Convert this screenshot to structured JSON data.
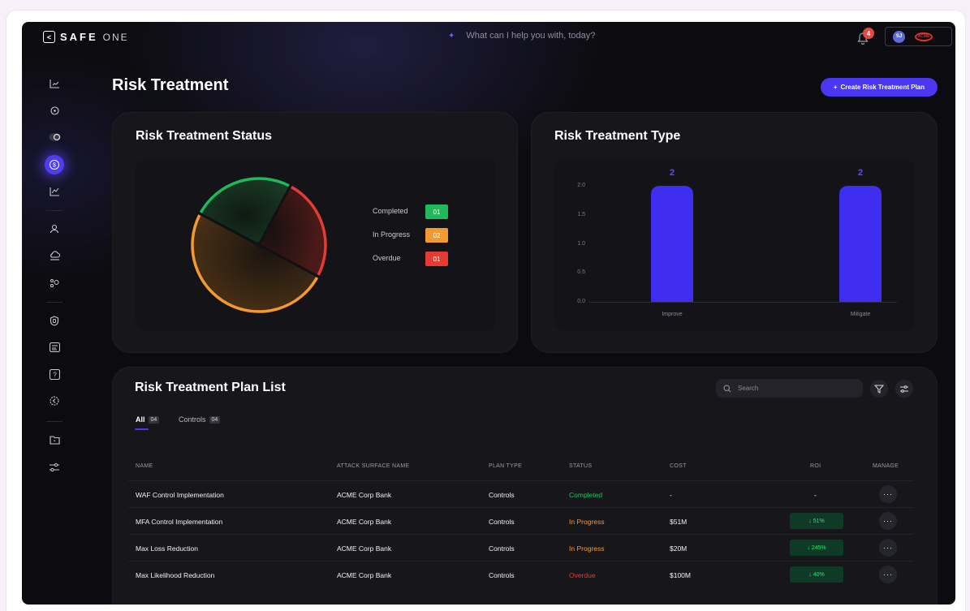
{
  "brand": {
    "logo_glyph": "<",
    "name_bold": "SAFE",
    "name_light": "ONE"
  },
  "assistant": {
    "placeholder": "What can I help you with, today?"
  },
  "notifications": {
    "count": "4"
  },
  "profile": {
    "initials": "SJ",
    "org_logo_text": "ACME"
  },
  "sidebar": {
    "items": [
      "chart-icon",
      "target-icon",
      "toggle-icon",
      "dollar-icon",
      "line-chart-icon",
      "user-icon",
      "cloud-icon",
      "nodes-icon",
      "shield-icon",
      "browser-icon",
      "help-icon",
      "settings-icon",
      "folder-icon",
      "sliders-icon"
    ],
    "active": "dollar-icon"
  },
  "page": {
    "title": "Risk Treatment",
    "create_label": "Create Risk Treatment Plan"
  },
  "status_card": {
    "title": "Risk Treatment Status",
    "legend": [
      {
        "label": "Completed",
        "value": "01",
        "color": "#1fb85a"
      },
      {
        "label": "In Progress",
        "value": "02",
        "color": "#f29a32"
      },
      {
        "label": "Overdue",
        "value": "01",
        "color": "#e63b32"
      }
    ]
  },
  "type_card": {
    "title": "Risk Treatment Type"
  },
  "chart_data": [
    {
      "type": "pie",
      "labels": [
        "Completed",
        "In Progress",
        "Overdue"
      ],
      "values": [
        1,
        2,
        1
      ],
      "colors": [
        "#1fb85a",
        "#f29a32",
        "#e63b32"
      ]
    },
    {
      "type": "bar",
      "categories": [
        "Improve",
        "Mitigate"
      ],
      "values": [
        2,
        2
      ],
      "data_labels": [
        "2",
        "2"
      ],
      "ylim": [
        0,
        2.0
      ],
      "yticks": [
        "2.0",
        "1.5",
        "1.0",
        "0.5",
        "0.0"
      ],
      "color": "#3f2ef0"
    }
  ],
  "list": {
    "title": "Risk Treatment Plan List",
    "search_placeholder": "Search",
    "tabs": [
      {
        "label": "All",
        "count": "04"
      },
      {
        "label": "Controls",
        "count": "04"
      }
    ],
    "columns": [
      "NAME",
      "ATTACK SURFACE NAME",
      "PLAN TYPE",
      "STATUS",
      "COST",
      "ROI",
      "MANAGE"
    ],
    "rows": [
      {
        "name": "WAF Control Implementation",
        "surface": "ACME Corp Bank",
        "plan": "Controls",
        "status": "Completed",
        "status_color": "#22c55e",
        "cost": "-",
        "roi": "-"
      },
      {
        "name": "MFA Control Implementation",
        "surface": "ACME Corp Bank",
        "plan": "Controls",
        "status": "In Progress",
        "status_color": "#f29a32",
        "cost": "$51M",
        "roi": "↓  51%"
      },
      {
        "name": "Max Loss Reduction",
        "surface": "ACME Corp Bank",
        "plan": "Controls",
        "status": "In Progress",
        "status_color": "#f29a32",
        "cost": "$20M",
        "roi": "↓  245%"
      },
      {
        "name": "Max Likelihood Reduction",
        "surface": "ACME Corp Bank",
        "plan": "Controls",
        "status": "Overdue",
        "status_color": "#e63b32",
        "cost": "$100M",
        "roi": "↓  40%"
      }
    ],
    "manage_label": "···"
  }
}
